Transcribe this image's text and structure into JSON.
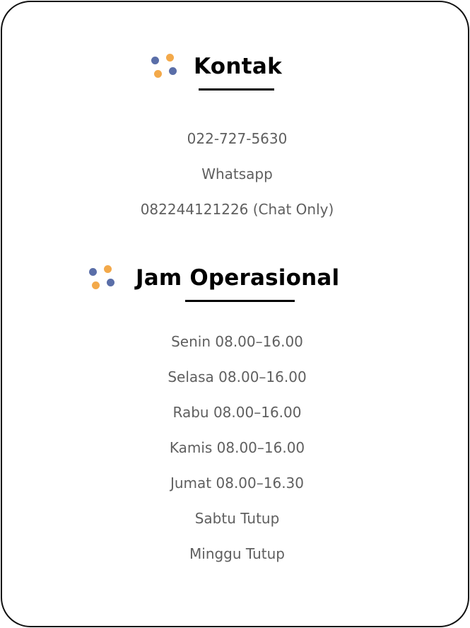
{
  "colors": {
    "dot_blue": "#5a6ea8",
    "dot_orange": "#f3a94a",
    "text_gray": "#5f5f5f",
    "title_black": "#000000"
  },
  "kontak": {
    "icon": "dots-icon",
    "title": "Kontak",
    "phone": "022-727-5630",
    "whatsapp_label": "Whatsapp",
    "whatsapp_number": "082244121226 (Chat Only)"
  },
  "jam_operasional": {
    "icon": "dots-icon",
    "title": "Jam Operasional",
    "days": [
      "Senin 08.00–16.00",
      "Selasa 08.00–16.00",
      "Rabu 08.00–16.00",
      "Kamis 08.00–16.00",
      "Jumat 08.00–16.30",
      "Sabtu Tutup",
      "Minggu Tutup"
    ]
  }
}
